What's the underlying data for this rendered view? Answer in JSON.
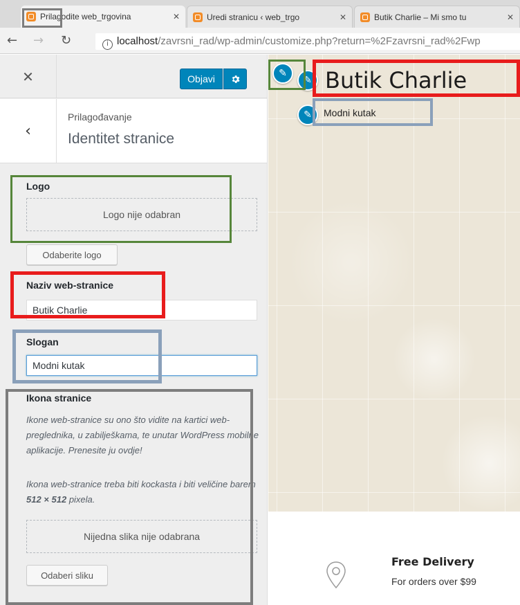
{
  "browser": {
    "tabs": [
      {
        "title": "Prilagodite web_trgovina",
        "active": true
      },
      {
        "title": "Uredi stranicu ‹ web_trgo",
        "active": false
      },
      {
        "title": "Butik Charlie – Mi smo tu",
        "active": false
      }
    ],
    "tab_close": "✕",
    "back_icon": "arrow-left",
    "forward_icon": "arrow-right",
    "reload_icon": "reload",
    "url_host": "localhost",
    "url_path": "/zavrsni_rad/wp-admin/customize.php?return=%2Fzavrsni_rad%2Fwp"
  },
  "customizer": {
    "close_label": "✕",
    "publish_label": "Objavi",
    "gear_icon": "gear",
    "back_label": "‹",
    "breadcrumb": "Prilagođavanje",
    "section_title": "Identitet stranice",
    "logo": {
      "label": "Logo",
      "placeholder": "Logo nije odabran",
      "button": "Odaberite logo"
    },
    "site_title": {
      "label": "Naziv web-stranice",
      "value": "Butik Charlie"
    },
    "tagline": {
      "label": "Slogan",
      "value": "Modni kutak"
    },
    "site_icon": {
      "label": "Ikona stranice",
      "description1": "Ikone web-stranice su ono što vidite na kartici web-preglednika, u zabilješkama, te unutar WordPress mobilne aplikacije. Prenesite ju ovdje!",
      "description2_prefix": "Ikona web-stranice treba biti kockasta i biti veličine barem ",
      "description2_size": "512 × 512",
      "description2_suffix": " pixela.",
      "placeholder": "Nijedna slika nije odabrana",
      "button": "Odaberi sliku"
    }
  },
  "preview": {
    "site_title": "Butik Charlie",
    "tagline": "Modni kutak",
    "feature_title": "Free Delivery",
    "feature_subtitle": "For orders over $99"
  },
  "highlight_colors": {
    "green": "#56863a",
    "red": "#e81c1c",
    "blue": "#8aa0ba",
    "gray": "#7d7d7d"
  },
  "accent": "#0085ba"
}
